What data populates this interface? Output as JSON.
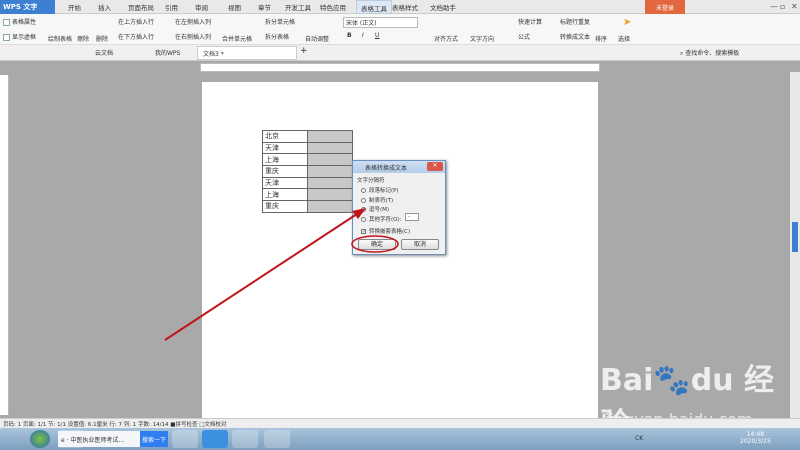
{
  "app": {
    "name": "WPS 文字",
    "login": "未登录"
  },
  "menu_tabs": [
    "开始",
    "插入",
    "页面布局",
    "引用",
    "审阅",
    "视图",
    "章节",
    "开发工具",
    "特色应用",
    "表格工具",
    "表格样式",
    "文档助手"
  ],
  "active_tab": "表格工具",
  "ribbon": {
    "table_props": "表格属性",
    "show_grid": "显示虚框",
    "draw_table": "绘制表格",
    "erase": "擦除",
    "delete": "删除",
    "insert_above": "在上方插入行",
    "insert_below": "在下方插入行",
    "insert_left": "在左侧插入列",
    "insert_right": "在右侧插入列",
    "merge": "合并单元格",
    "split_cell": "拆分单元格",
    "split_table": "拆分表格",
    "autofit": "自动调整",
    "font": "宋体 (正文)",
    "bold": "B",
    "italic": "I",
    "underline": "U",
    "align": "对齐方式",
    "text_dir": "文字方向",
    "quick_calc": "快速计算",
    "formula": "公式",
    "repeat_header": "标题行重复",
    "to_text": "转换成文本",
    "sort": "排序",
    "select": "选择"
  },
  "doc_tabs": [
    {
      "label": "云文档"
    },
    {
      "label": "我的WPS"
    },
    {
      "label": "文档3 *"
    }
  ],
  "search_placeholder": "查找命令、搜索模板",
  "table_rows": [
    "北京",
    "天津",
    "上海",
    "重庆",
    "天津",
    "上海",
    "重庆"
  ],
  "dialog": {
    "title": "表格转换成文本",
    "group": "文字分隔符",
    "options": [
      "段落标记(P)",
      "制表符(T)",
      "逗号(M)",
      "其他字符(O):"
    ],
    "selected": 2,
    "other_value": "-",
    "checkbox": "转换嵌套表格(C)",
    "checkbox_checked": true,
    "ok": "确定",
    "cancel": "取消"
  },
  "status": "页码: 1  页面: 1/1  节: 1/1  设置值: 6.1厘米  行: 7  列: 1  字数: 14/14  ■拼写检查  □文档校对",
  "taskbar": {
    "ie_title": "中医执业医师考试...",
    "search_btn": "搜索一下",
    "lang": "CK",
    "time": "14:48",
    "date": "2020/3/25"
  },
  "watermark": {
    "logo": "Baidu经验",
    "url": "jingyan.baidu.com"
  },
  "colors": {
    "accent": "#3d7fd1",
    "login": "#e2673e",
    "annotation": "#c0141b"
  }
}
